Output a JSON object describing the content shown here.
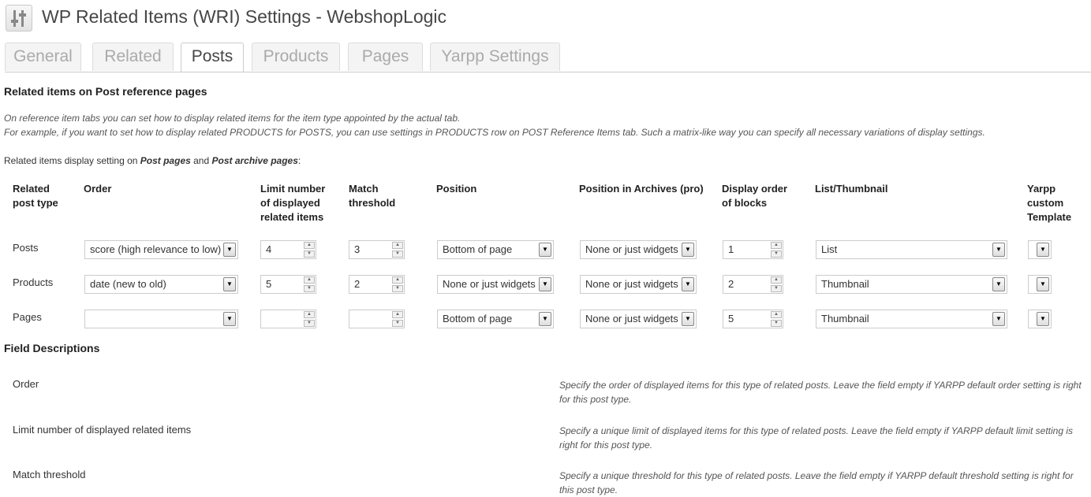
{
  "page": {
    "title": "WP Related Items (WRI) Settings - WebshopLogic"
  },
  "tabs": [
    {
      "label": "General",
      "active": false
    },
    {
      "label": "Related",
      "active": false
    },
    {
      "label": "Posts",
      "active": true
    },
    {
      "label": "Products",
      "active": false
    },
    {
      "label": "Pages",
      "active": false
    },
    {
      "label": "Yarpp Settings",
      "active": false
    }
  ],
  "section": {
    "heading": "Related items on Post reference pages",
    "note_line1": "On reference item tabs you can set how to display related items for the item type appointed by the actual tab.",
    "note_line2": "For example, if you want to set how to display related PRODUCTS for POSTS, you can use settings in PRODUCTS row on POST Reference Items tab. Such a matrix-like way you can specify all necessary variations of display settings.",
    "intro_prefix": "Related items display setting on ",
    "intro_em1": "Post pages",
    "intro_mid": " and ",
    "intro_em2": "Post archive pages",
    "intro_suffix": ":"
  },
  "table": {
    "headers": {
      "post_type": "Related post type",
      "order": "Order",
      "limit": "Limit number of displayed related items",
      "threshold": "Match threshold",
      "position": "Position",
      "position_archives": "Position in Archives (pro)",
      "display_order": "Display order of blocks",
      "list_thumbnail": "List/Thumbnail",
      "yarpp_template": "Yarpp custom Template"
    },
    "rows": [
      {
        "type": "Posts",
        "order": "score (high relevance to low)",
        "limit": "4",
        "threshold": "3",
        "position": "Bottom of page",
        "position_archives": "None or just widgets",
        "display_order": "1",
        "list_thumbnail": "List",
        "yarpp_template": ""
      },
      {
        "type": "Products",
        "order": "date (new to old)",
        "limit": "5",
        "threshold": "2",
        "position": "None or just widgets",
        "position_archives": "None or just widgets",
        "display_order": "2",
        "list_thumbnail": "Thumbnail",
        "yarpp_template": ""
      },
      {
        "type": "Pages",
        "order": "",
        "limit": "",
        "threshold": "",
        "position": "Bottom of page",
        "position_archives": "None or just widgets",
        "display_order": "5",
        "list_thumbnail": "Thumbnail",
        "yarpp_template": ""
      }
    ]
  },
  "field_descriptions": {
    "heading": "Field Descriptions",
    "items": [
      {
        "label": "Order",
        "desc": "Specify the order of displayed items for this type of related posts. Leave the field empty if YARPP default order setting is right for this post type."
      },
      {
        "label": "Limit number of displayed related items",
        "desc": "Specify a unique limit of displayed items for this type of related posts. Leave the field empty if YARPP default limit setting is right for this post type."
      },
      {
        "label": "Match threshold",
        "desc": "Specify a unique threshold for this type of related posts. Leave the field empty if YARPP default threshold setting is right for this post type."
      }
    ]
  },
  "icons": {
    "title": "settings-icon",
    "select": "dropdown-arrow-icon",
    "spin": "spinner-arrows-icon"
  }
}
